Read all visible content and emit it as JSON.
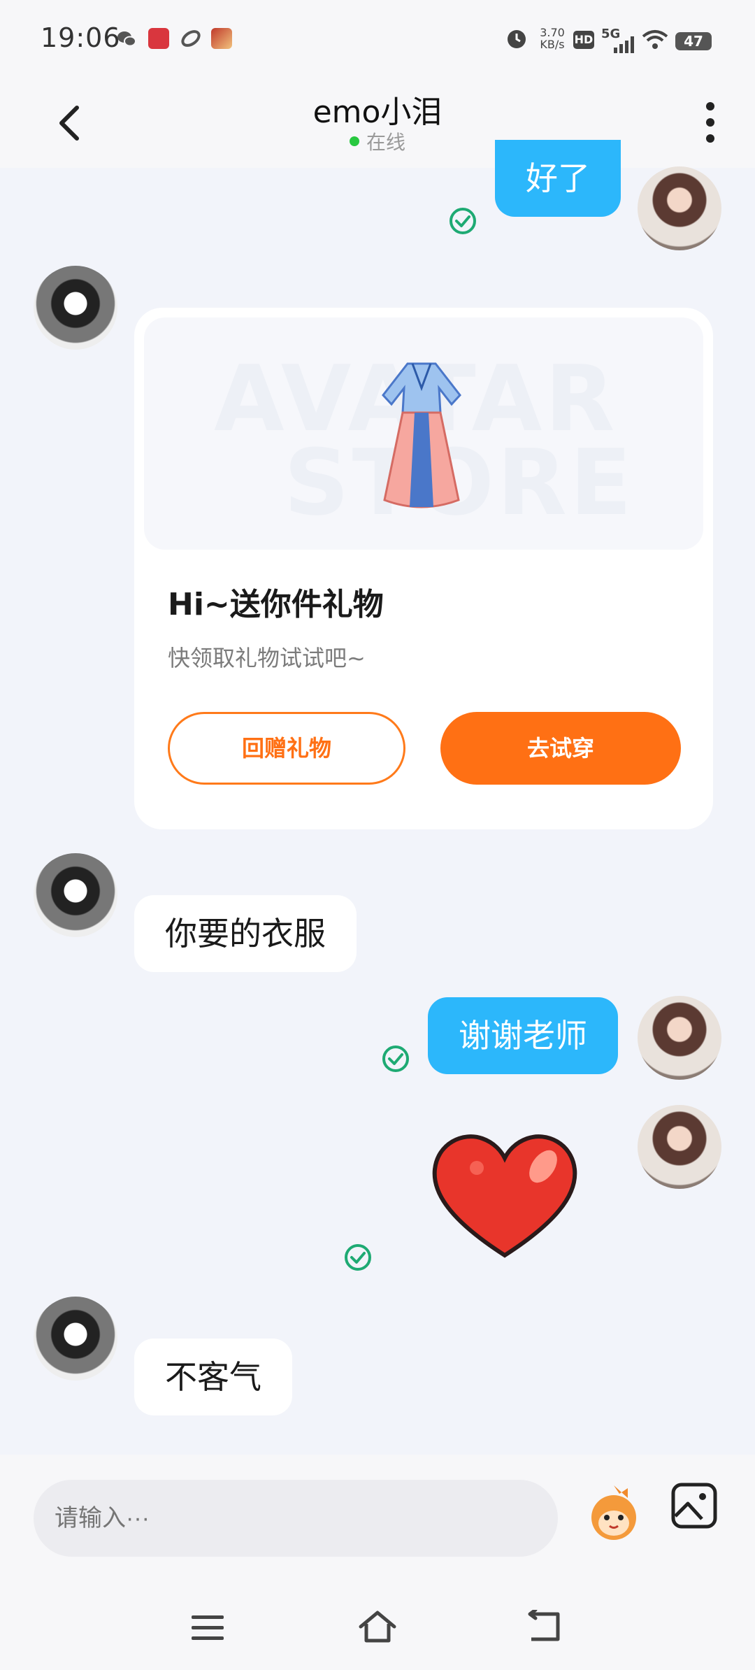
{
  "status_bar": {
    "time": "19:06",
    "net_speed": "3.70",
    "net_speed_unit": "KB/s",
    "hd": "HD",
    "network": "5G",
    "battery": "47"
  },
  "header": {
    "title": "emo小泪",
    "presence": "在线"
  },
  "messages": {
    "m1": "好了",
    "gift_title": "Hi~送你件礼物",
    "gift_sub": "快领取礼物试试吧~",
    "gift_btn_return": "回赠礼物",
    "gift_btn_try": "去试穿",
    "gift_watermark_1": "AVATAR",
    "gift_watermark_2": "STORE",
    "m3": "你要的衣服",
    "m4": "谢谢老师",
    "m6": "不客气"
  },
  "composer": {
    "placeholder": "请输入···"
  },
  "colors": {
    "outgoing_bubble": "#2cb7fb",
    "incoming_bubble": "#ffffff",
    "accent_orange": "#ff7014",
    "online": "#28c840",
    "read_check": "#1eaa73"
  },
  "icons": {
    "back": "back-arrow-icon",
    "more": "more-vertical-icon",
    "read": "read-check-icon",
    "heart": "heart-sticker",
    "mascot": "mascot-emoji-icon",
    "image": "image-picker-icon",
    "menu": "menu-icon",
    "home": "home-icon",
    "nav_back": "nav-back-icon"
  }
}
